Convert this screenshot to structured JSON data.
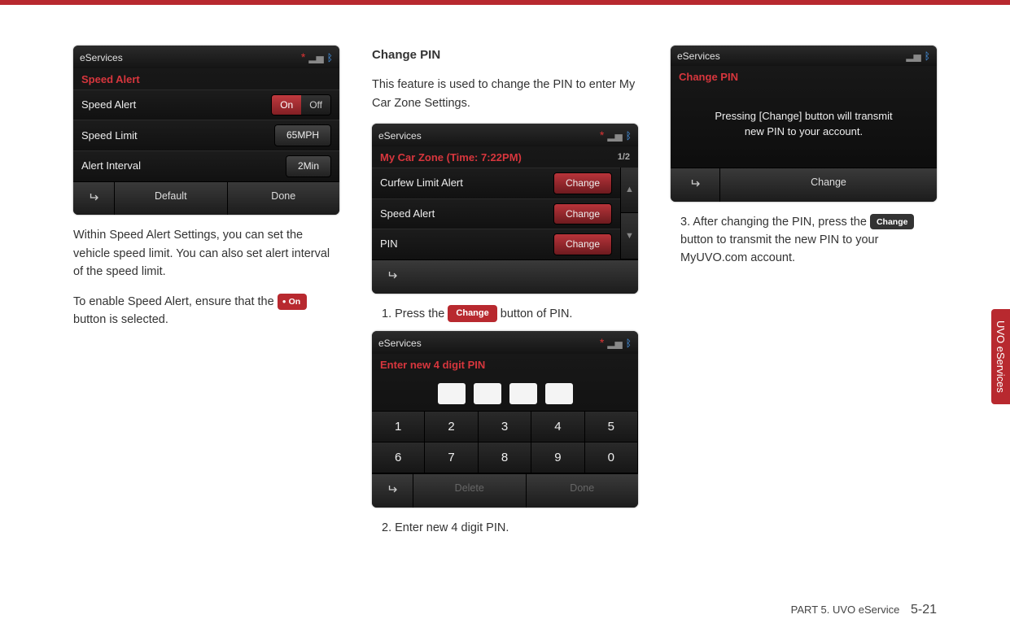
{
  "sideTab": "UVO eServices",
  "footer": {
    "part": "PART 5. UVO eService",
    "page": "5-21"
  },
  "col1": {
    "shot": {
      "title": "eServices",
      "section": "Speed Alert",
      "rows": [
        {
          "label": "Speed Alert",
          "on": "On",
          "off": "Off"
        },
        {
          "label": "Speed Limit",
          "value": "65MPH"
        },
        {
          "label": "Alert Interval",
          "value": "2Min"
        }
      ],
      "footer": {
        "default": "Default",
        "done": "Done"
      }
    },
    "p1": "Within Speed Alert Settings, you can set the vehicle speed limit. You can also set alert interval of the speed limit.",
    "p2a": "To enable Speed Alert, ensure that the ",
    "onBtn": "On",
    "p2b": " button is selected."
  },
  "col2": {
    "heading": "Change PIN",
    "intro": "This feature is used to change the PIN to enter My Car Zone Settings.",
    "shot1": {
      "title": "eServices",
      "section": "My Car Zone (Time: 7:22PM)",
      "pager": "1/2",
      "rows": [
        {
          "label": "Curfew Limit Alert",
          "btn": "Change"
        },
        {
          "label": "Speed Alert",
          "btn": "Change"
        },
        {
          "label": "PIN",
          "btn": "Change"
        }
      ]
    },
    "step1a": "1. Press the ",
    "changeBtn": "Change",
    "step1b": " button of PIN.",
    "shot2": {
      "title": "eServices",
      "section": "Enter new 4 digit PIN",
      "keys": [
        "1",
        "2",
        "3",
        "4",
        "5",
        "6",
        "7",
        "8",
        "9",
        "0"
      ],
      "footer": {
        "delete": "Delete",
        "done": "Done"
      }
    },
    "step2": "2. Enter new 4 digit PIN."
  },
  "col3": {
    "shot": {
      "title": "eServices",
      "section": "Change PIN",
      "msg1": "Pressing [Change] button will transmit",
      "msg2": "new PIN to your account.",
      "footer": {
        "change": "Change"
      }
    },
    "step3a": "3. After changing the PIN, press the ",
    "changeBtn": "Change",
    "step3b": " button to transmit the new PIN to your MyUVO.com account."
  }
}
